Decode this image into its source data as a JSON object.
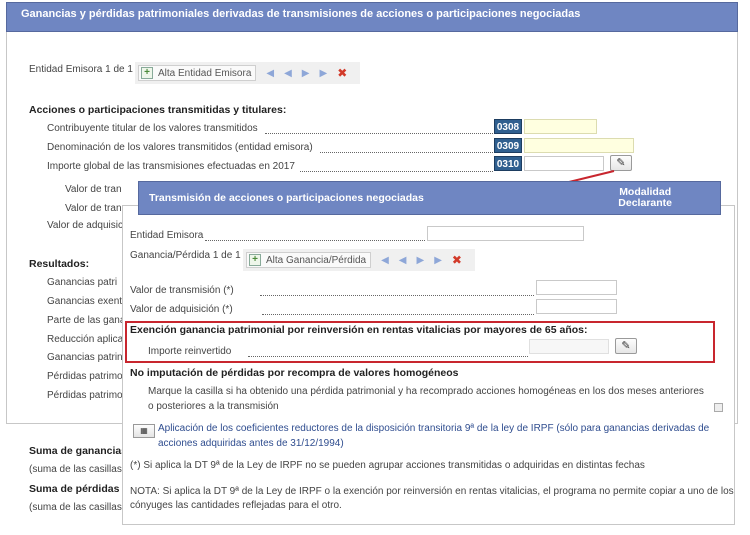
{
  "main": {
    "title": "Ganancias y pérdidas patrimoniales derivadas de transmisiones de acciones o participaciones negociadas",
    "entidad_counter": "Entidad Emisora 1 de 1",
    "alta_entidad_label": "Alta Entidad Emisora",
    "section_acciones": "Acciones o participaciones transmitidas y titulares:",
    "rows": [
      {
        "label": "Contribuyente titular de los valores transmitidos",
        "code": "0308"
      },
      {
        "label": "Denominación de los valores transmitidos (entidad emisora)",
        "code": "0309"
      },
      {
        "label": "Importe global de las transmisiones efectuadas en 2017",
        "code": "0310"
      }
    ],
    "sub_rows": [
      "Valor de tran",
      "Valor de tran",
      "Valor de adquisició"
    ],
    "section_resultados": "Resultados:",
    "result_rows": [
      "Ganancias patri",
      "Ganancias exent",
      "Parte de las gana",
      "Reducción aplica",
      "Ganancias patrin",
      "Pérdidas patrimo",
      "Pérdidas patrimo"
    ],
    "suma_ganancias": "Suma de ganancias",
    "suma_casillas_1": "(suma de las casillas",
    "suma_perdidas": "Suma de pérdidas p",
    "suma_casillas_2": "(suma de las casillas"
  },
  "modal": {
    "title": "Transmisión de acciones o participaciones negociadas",
    "right_header_line1": "Modalidad",
    "right_header_line2": "Declarante",
    "entidad_label": "Entidad Emisora",
    "ganancia_counter": "Ganancia/Pérdida 1 de 1",
    "alta_ganancia_label": "Alta Ganancia/Pérdida",
    "valor_transmision": "Valor de transmisión (*)",
    "valor_adquisicion": "Valor de adquisición (*)",
    "exencion_title": "Exención ganancia patrimonial por reinversión en rentas vitalicias por mayores de 65 años:",
    "importe_reinvertido": "Importe reinvertido",
    "no_imputacion_title": "No imputación de pérdidas por recompra de valores homogéneos",
    "marque_line1": "Marque la casilla si ha obtenido una pérdida patrimonial y ha recomprado acciones homogéneas en los dos meses anteriores",
    "marque_line2": "o posteriores a la transmisión",
    "coef_line1": "Aplicación de los coeficientes reductores de la disposición transitoria 9ª de la ley de IRPF (sólo para ganancias derivadas de",
    "coef_line2": "acciones adquiridas antes de 31/12/1994)",
    "note_dt9": "(*) Si aplica la DT 9ª de la Ley de IRPF no se pueden agrupar acciones transmitidas o adquiridas en distintas fechas",
    "nota_line1": "NOTA: Si aplica la DT 9ª de la Ley de IRPF o la exención por reinversión en rentas vitalicias, el programa no permite copiar a uno de los",
    "nota_line2": "cónyuges las cantidades reflejadas para el otro."
  },
  "icons": {
    "pen": "✎",
    "first": "◀",
    "prev": "◀",
    "next": "▶",
    "last": "▶",
    "delete": "✖",
    "plus": "+",
    "calc": "▦"
  },
  "colors": {
    "header_bg": "#6f86c2",
    "code_bg": "#2f5f8f",
    "highlight_border": "#c8262e",
    "arrow": "#c8262e"
  }
}
